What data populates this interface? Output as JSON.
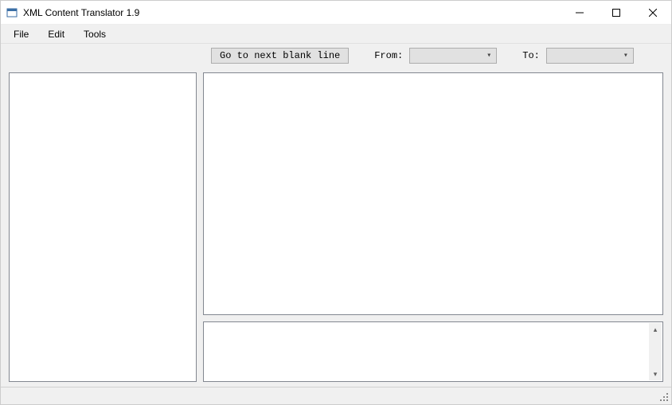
{
  "window": {
    "title": "XML Content Translator 1.9"
  },
  "menu": {
    "file": "File",
    "edit": "Edit",
    "tools": "Tools"
  },
  "toolbar": {
    "goto_blank": "Go to next blank line",
    "from_label": "From:",
    "to_label": "To:",
    "from_value": "",
    "to_value": ""
  }
}
